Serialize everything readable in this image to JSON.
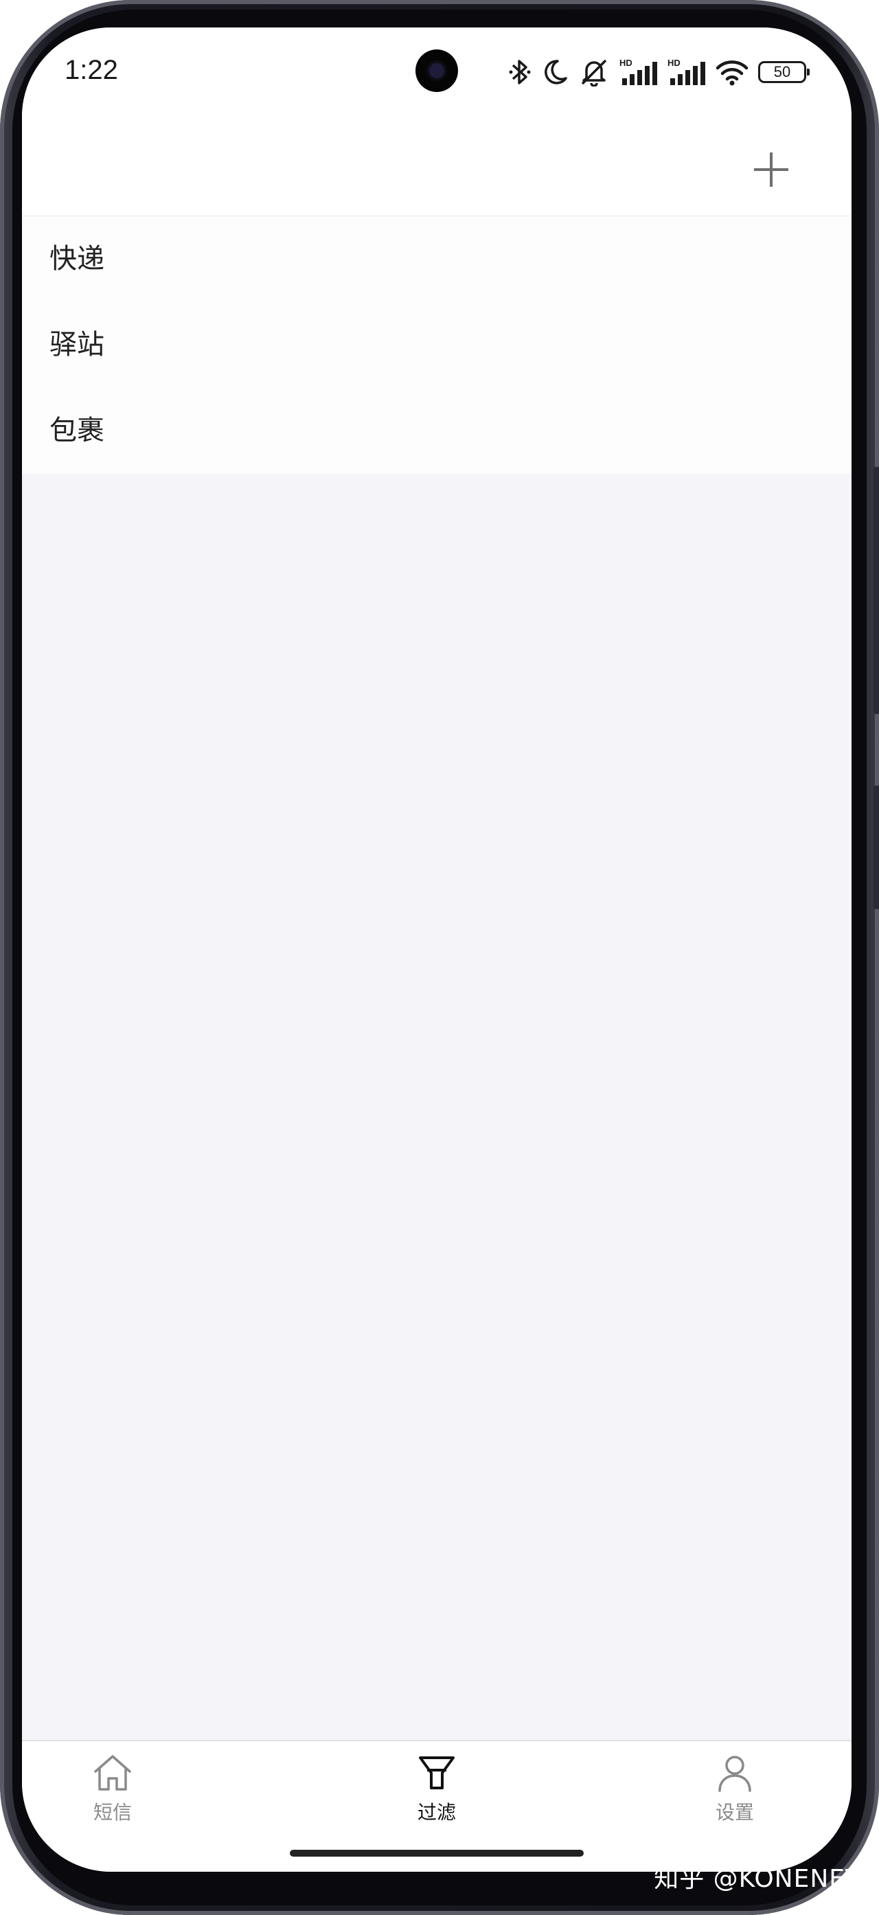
{
  "status_bar": {
    "time": "1:22",
    "battery": "50",
    "icons": [
      "bluetooth-icon",
      "do-not-disturb-moon-icon",
      "mute-bell-icon",
      "hd-signal-icon",
      "hd-signal-icon",
      "wifi-icon",
      "battery-icon"
    ]
  },
  "header": {
    "action_icon": "plus-icon"
  },
  "filters": [
    {
      "label": "快递"
    },
    {
      "label": "驿站"
    },
    {
      "label": "包裹"
    }
  ],
  "tabs": [
    {
      "label": "短信",
      "icon": "home-icon",
      "active": false
    },
    {
      "label": "过滤",
      "icon": "filter-funnel-icon",
      "active": true
    },
    {
      "label": "设置",
      "icon": "user-icon",
      "active": false
    }
  ],
  "watermark": "知乎 @KONENET",
  "colors": {
    "background": "#f4f4f9",
    "active_tab": "#111111",
    "inactive_tab": "#8a8a8a"
  }
}
